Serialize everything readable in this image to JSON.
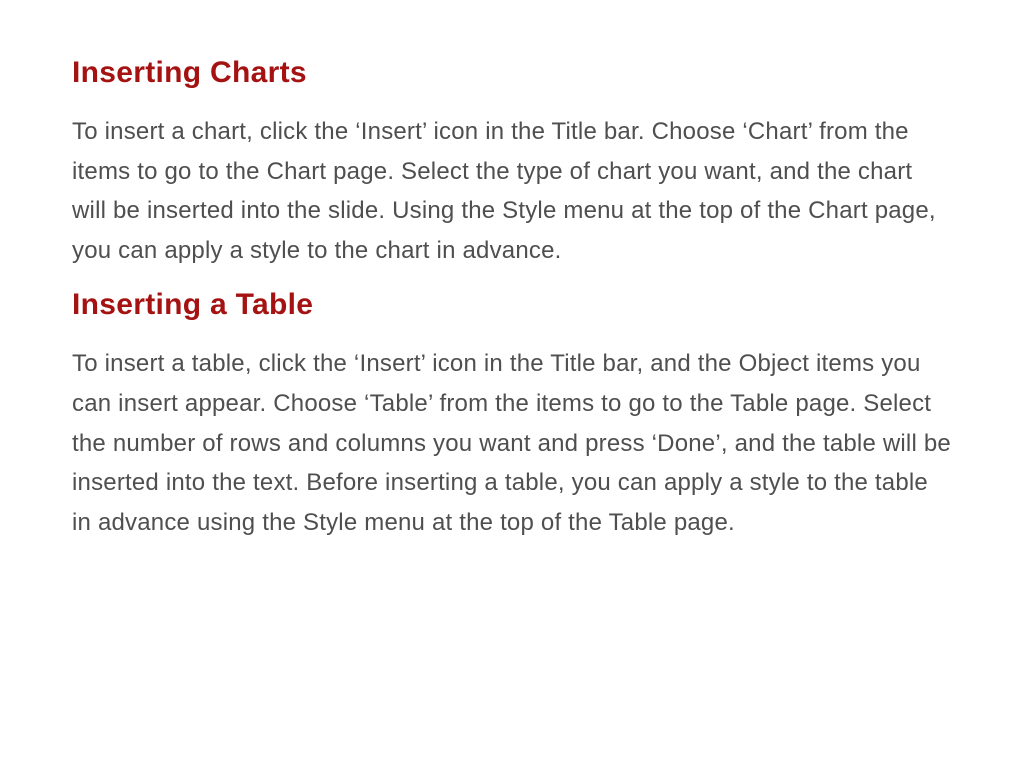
{
  "sections": [
    {
      "heading": "Inserting Charts",
      "body": "To insert a chart, click the ‘Insert’ icon in the Title bar. Choose ‘Chart’ from the items to go to the Chart page. Select the type of chart you want, and the chart will be inserted into the slide. Using the Style menu at the top of the Chart page, you can apply a style to the chart in advance."
    },
    {
      "heading": "Inserting a Table",
      "body": "To insert a table, click the ‘Insert’ icon in the Title bar, and the Object items you can insert appear. Choose ‘Table’ from the items to go to the Table page. Select the number of rows and columns you want and press ‘Done’, and the table will be inserted into the text. Before inserting a table, you can apply a style to the table in advance using the Style menu at the top of the Table page."
    }
  ]
}
